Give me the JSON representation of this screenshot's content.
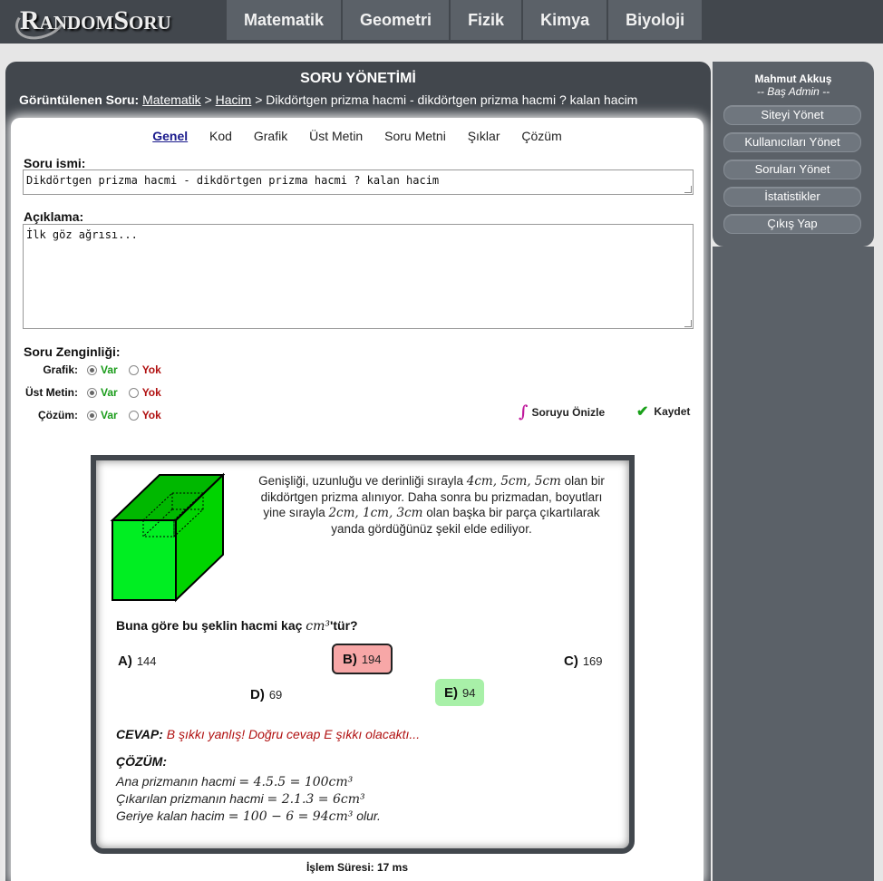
{
  "header": {
    "logo": "RandomSoru",
    "nav": [
      "Matematik",
      "Geometri",
      "Fizik",
      "Kimya",
      "Biyoloji"
    ]
  },
  "page": {
    "title": "SORU YÖNETİMİ",
    "breadcrumb_prefix": "Görüntülenen Soru:",
    "breadcrumb_link1": "Matematik",
    "breadcrumb_sep": ">",
    "breadcrumb_link2": "Hacim",
    "breadcrumb_tail": "> Dikdörtgen prizma hacmi - dikdörtgen prizma hacmi ? kalan hacim"
  },
  "tabs": [
    "Genel",
    "Kod",
    "Grafik",
    "Üst Metin",
    "Soru Metni",
    "Şıklar",
    "Çözüm"
  ],
  "form": {
    "soru_ismi_label": "Soru ismi:",
    "soru_ismi_value": "Dikdörtgen prizma hacmi - dikdörtgen prizma hacmi ? kalan hacim",
    "aciklama_label": "Açıklama:",
    "aciklama_value": "İlk göz ağrısı...",
    "zenginlik_label": "Soru Zenginliği:",
    "rows": [
      {
        "label": "Grafik:",
        "var": "Var",
        "yok": "Yok"
      },
      {
        "label": "Üst Metin:",
        "var": "Var",
        "yok": "Yok"
      },
      {
        "label": "Çözüm:",
        "var": "Var",
        "yok": "Yok"
      }
    ],
    "preview_label": "Soruyu Önizle",
    "save_label": "Kaydet"
  },
  "question": {
    "text_l1a": "Genişliği, uzunluğu ve derinliği sırayla ",
    "text_l1m": "4cm, 5cm, 5cm",
    "text_l1b": " olan bir",
    "text_l2": "dikdörtgen prizma alınıyor. Daha sonra bu prizmadan, boyutları",
    "text_l3a": "yine sırayla ",
    "text_l3m": "2cm, 1cm, 3cm",
    "text_l3b": " olan başka bir parça çıkartılarak",
    "text_l4": "yanda gördüğünüz şekil elde ediliyor.",
    "prompt_a": "Buna göre bu şeklin hacmi kaç ",
    "prompt_m": "cm³",
    "prompt_b": "'tür?",
    "options": [
      {
        "letter": "A)",
        "value": "144"
      },
      {
        "letter": "B)",
        "value": "194"
      },
      {
        "letter": "C)",
        "value": "169"
      },
      {
        "letter": "D)",
        "value": "69"
      },
      {
        "letter": "E)",
        "value": "94"
      }
    ],
    "cevap_label": "CEVAP:",
    "cevap_text": " B şıkkı yanlış! Doğru cevap E şıkkı olacaktı...",
    "cozum_title": "ÇÖZÜM:",
    "cozum1_a": "Ana prizmanın hacmi ",
    "cozum1_m": "= 4.5.5 = 100cm³",
    "cozum2_a": "Çıkarılan prizmanın hacmi ",
    "cozum2_m": "= 2.1.3 = 6cm³",
    "cozum3_a": "Geriye kalan hacim ",
    "cozum3_m": "= 100 − 6 = 94cm³",
    "cozum3_b": " olur."
  },
  "footer": {
    "islem": "İşlem Süresi: 17 ms"
  },
  "sidebar": {
    "user": "Mahmut Akkuş",
    "role": "-- Baş Admin --",
    "buttons": [
      "Siteyi Yönet",
      "Kullanıcıları Yönet",
      "Soruları Yönet",
      "İstatistikler",
      "Çıkış Yap"
    ]
  },
  "colors": {
    "cube_front": "#00e600",
    "cube_top": "#00b800",
    "cube_side": "#00cc00",
    "wrong": "#f7a7a7",
    "right": "#a8f0a8"
  }
}
